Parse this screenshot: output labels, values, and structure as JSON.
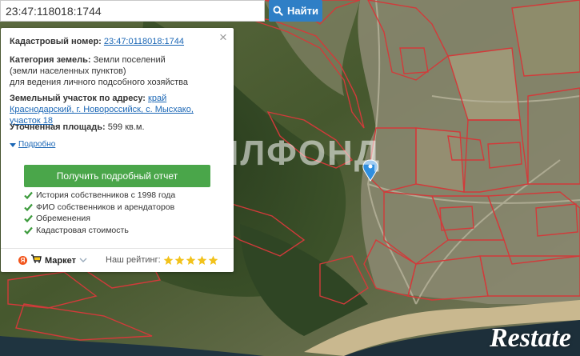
{
  "search": {
    "value": "23:47:118018:1744",
    "button_label": "Найти",
    "icon": "search-icon"
  },
  "info_panel": {
    "cadastral_label": "Кадастровый номер:",
    "cadastral_value": "23:47:0118018:1744",
    "category_label": "Категория земель:",
    "category_value": "Земли поселений (земли населенных пунктов)",
    "category_usage": "для ведения личного подсобного хозяйства",
    "address_label": "Земельный участок по адресу:",
    "address_value": "край Краснодарский, г. Новороссийск, с. Мысхако, участок 18",
    "area_label": "Уточненная площадь:",
    "area_value": "599 кв.м.",
    "more_link": "Подробно",
    "report_button": "Получить подробный отчет",
    "features": [
      "История собственников с 1998 года",
      "ФИО собственников и арендаторов",
      "Обременения",
      "Кадастровая стоимость"
    ],
    "market_label": "Маркет",
    "ya_letter": "Я",
    "rating_label": "Наш рейтинг:",
    "rating_stars": 5,
    "close": "×"
  },
  "overlays": {
    "watermark": "ЖИЛФОНД",
    "logo": "Restate"
  },
  "colors": {
    "accent": "#2f7fc6",
    "report_button": "#4aa64a",
    "link": "#1a66b5",
    "star": "#f2c21b",
    "parcel_border": "#d23a3a",
    "marker": "#2f8fe0",
    "sea": "#1d2f3a"
  }
}
